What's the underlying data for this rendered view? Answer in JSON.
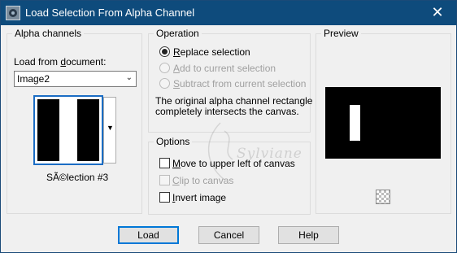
{
  "window": {
    "title": "Load Selection From Alpha Channel",
    "close_glyph": "✕"
  },
  "alpha_channels": {
    "title": "Alpha channels",
    "load_from_label": "Load from document:",
    "document_selected": "Image2",
    "channel_name": "SÃ©lection #3"
  },
  "operation": {
    "title": "Operation",
    "options": [
      {
        "label": "Replace selection",
        "checked": true,
        "enabled": true
      },
      {
        "label": "Add to current selection",
        "checked": false,
        "enabled": false
      },
      {
        "label": "Subtract from current selection",
        "checked": false,
        "enabled": false
      }
    ],
    "info_line1": "The original alpha channel rectangle",
    "info_line2": "completely intersects the canvas."
  },
  "options": {
    "title": "Options",
    "items": [
      {
        "label": "Move to upper left of canvas",
        "checked": false,
        "enabled": true
      },
      {
        "label": "Clip to canvas",
        "checked": false,
        "enabled": false
      },
      {
        "label": "Invert image",
        "checked": false,
        "enabled": true
      }
    ]
  },
  "preview": {
    "title": "Preview",
    "toggle_icon": "checkerboard-icon"
  },
  "buttons": {
    "load": "Load",
    "cancel": "Cancel",
    "help": "Help"
  },
  "watermark": {
    "text": "Sylviane"
  },
  "colors": {
    "titlebar": "#0e4b7c",
    "accent": "#0078d7",
    "dialog_bg": "#f0f0f0"
  }
}
